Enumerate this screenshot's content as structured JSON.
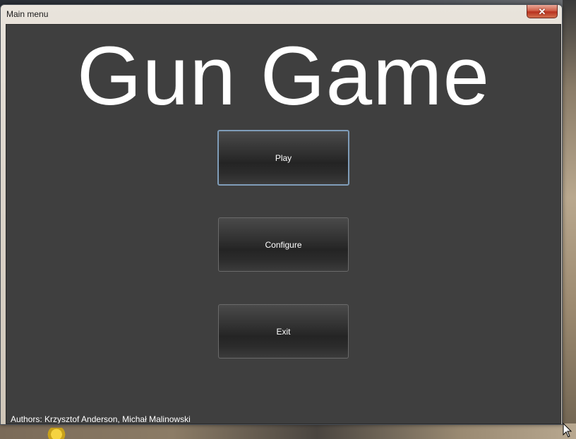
{
  "window": {
    "title": "Main menu",
    "close_glyph": "✕"
  },
  "main": {
    "game_title": "Gun Game",
    "buttons": {
      "play": "Play",
      "configure": "Configure",
      "exit": "Exit"
    },
    "authors": "Authors: Krzysztof Anderson, Michał Malinowski"
  },
  "colors": {
    "client_background": "#3f3f3f",
    "title_text": "#ffffff",
    "focus_border": "#7f9db9",
    "close_button": "#c8402a"
  },
  "icons": {
    "close": "close-icon",
    "cursor": "mouse-pointer-icon"
  }
}
